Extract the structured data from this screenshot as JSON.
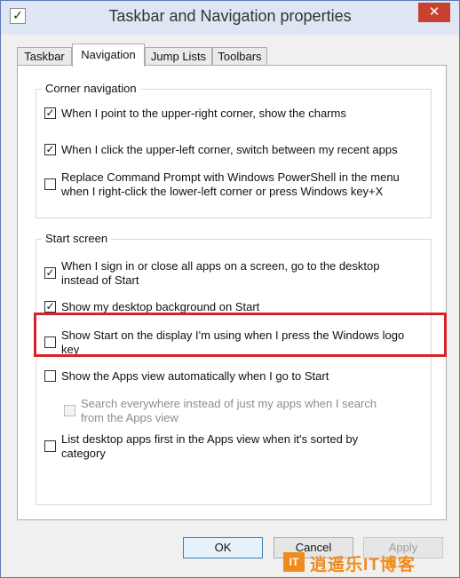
{
  "window": {
    "title": "Taskbar and Navigation properties",
    "close_glyph": "✕",
    "icon": "checkbox-app-icon"
  },
  "tabs": [
    {
      "label": "Taskbar",
      "active": false
    },
    {
      "label": "Navigation",
      "active": true
    },
    {
      "label": "Jump Lists",
      "active": false
    },
    {
      "label": "Toolbars",
      "active": false
    }
  ],
  "corner_navigation": {
    "title": "Corner navigation",
    "options": [
      {
        "line1": "When I point to the upper-right corner, show the charms",
        "line2": "",
        "checked": true
      },
      {
        "line1": "When I click the upper-left corner, switch between my recent apps",
        "line2": "",
        "checked": true
      },
      {
        "line1": "Replace Command Prompt with Windows PowerShell in the menu",
        "line2": "when I right-click the lower-left corner or press Windows key+X",
        "checked": false
      }
    ]
  },
  "start_screen": {
    "title": "Start screen",
    "options": [
      {
        "line1": "When I sign in or close all apps on a screen, go to the desktop",
        "line2": "instead of Start",
        "checked": true
      },
      {
        "line1": "Show my desktop background on Start",
        "line2": "",
        "checked": true
      },
      {
        "line1": "Show Start on the display I'm using when I press the Windows logo",
        "line2": "key",
        "checked": false
      },
      {
        "line1": "Show the Apps view automatically when I go to Start",
        "line2": "",
        "checked": false
      },
      {
        "line1": "Search everywhere instead of just my apps when I search",
        "line2": "from the Apps view",
        "checked": false,
        "disabled": true
      },
      {
        "line1": "List desktop apps first in the Apps view when it's sorted by",
        "line2": "category",
        "checked": false
      }
    ]
  },
  "buttons": {
    "ok": "OK",
    "cancel": "Cancel",
    "apply": "Apply"
  },
  "check_glyph": "✓",
  "watermark": {
    "logo": "IT",
    "text": "逍遥乐IT博客"
  },
  "colors": {
    "highlight": "#d8232a",
    "accent": "#3c7fb1",
    "watermark": "#f08a1c"
  }
}
